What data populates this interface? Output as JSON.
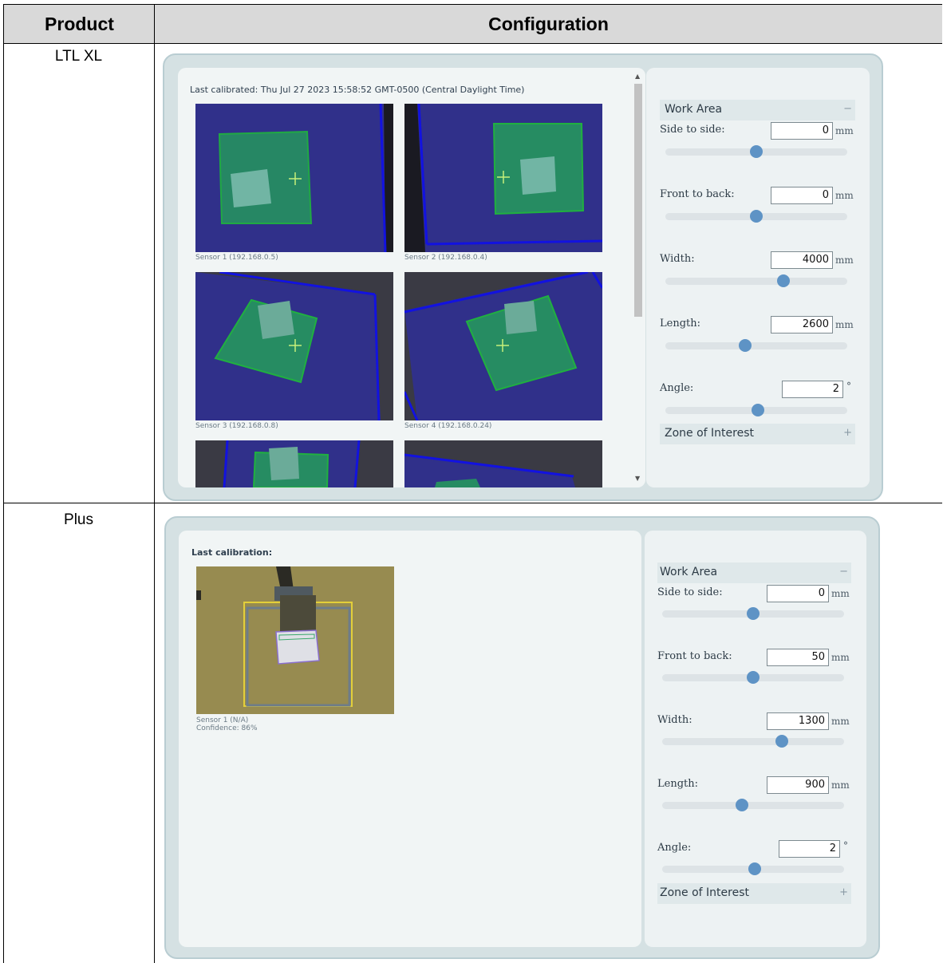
{
  "table": {
    "headers": {
      "product": "Product",
      "configuration": "Configuration"
    },
    "rows": [
      {
        "product": "LTL XL",
        "calibration_text": "Last calibrated: Thu Jul 27 2023 15:58:52 GMT-0500 (Central Daylight Time)",
        "sensors": [
          {
            "label": "Sensor 1 (192.168.0.5)"
          },
          {
            "label": "Sensor 2 (192.168.0.4)"
          },
          {
            "label": "Sensor 3 (192.168.0.8)"
          },
          {
            "label": "Sensor 4 (192.168.0.24)"
          }
        ],
        "settings": {
          "section_title": "Work Area",
          "section_toggle": "−",
          "fields": [
            {
              "label": "Side to side:",
              "value": "0",
              "unit": "mm",
              "slider": 0.5
            },
            {
              "label": "Front to back:",
              "value": "0",
              "unit": "mm",
              "slider": 0.5
            },
            {
              "label": "Width:",
              "value": "4000",
              "unit": "mm",
              "slider": 0.65
            },
            {
              "label": "Length:",
              "value": "2600",
              "unit": "mm",
              "slider": 0.44
            },
            {
              "label": "Angle:",
              "value": "2",
              "unit": "°",
              "slider": 0.51
            }
          ],
          "zone_title": "Zone of Interest",
          "zone_toggle": "+"
        }
      },
      {
        "product": "Plus",
        "calibration_text": "Last calibration:",
        "sensors": [
          {
            "label": "Sensor 1 (N/A)",
            "confidence": "Confidence: 86%"
          }
        ],
        "settings": {
          "section_title": "Work Area",
          "section_toggle": "−",
          "fields": [
            {
              "label": "Side to side:",
              "value": "0",
              "unit": "mm",
              "slider": 0.5
            },
            {
              "label": "Front to back:",
              "value": "50",
              "unit": "mm",
              "slider": 0.5
            },
            {
              "label": "Width:",
              "value": "1300",
              "unit": "mm",
              "slider": 0.66
            },
            {
              "label": "Length:",
              "value": "900",
              "unit": "mm",
              "slider": 0.44
            },
            {
              "label": "Angle:",
              "value": "2",
              "unit": "°",
              "slider": 0.51
            }
          ],
          "zone_title": "Zone of Interest",
          "zone_toggle": "+"
        }
      }
    ]
  },
  "colors": {
    "work_area_overlay": "#1d8a5e",
    "sensor_background": "#2e2e9c",
    "boundary_line": "#0f0fd8",
    "slider_thumb": "#5e93c5"
  }
}
